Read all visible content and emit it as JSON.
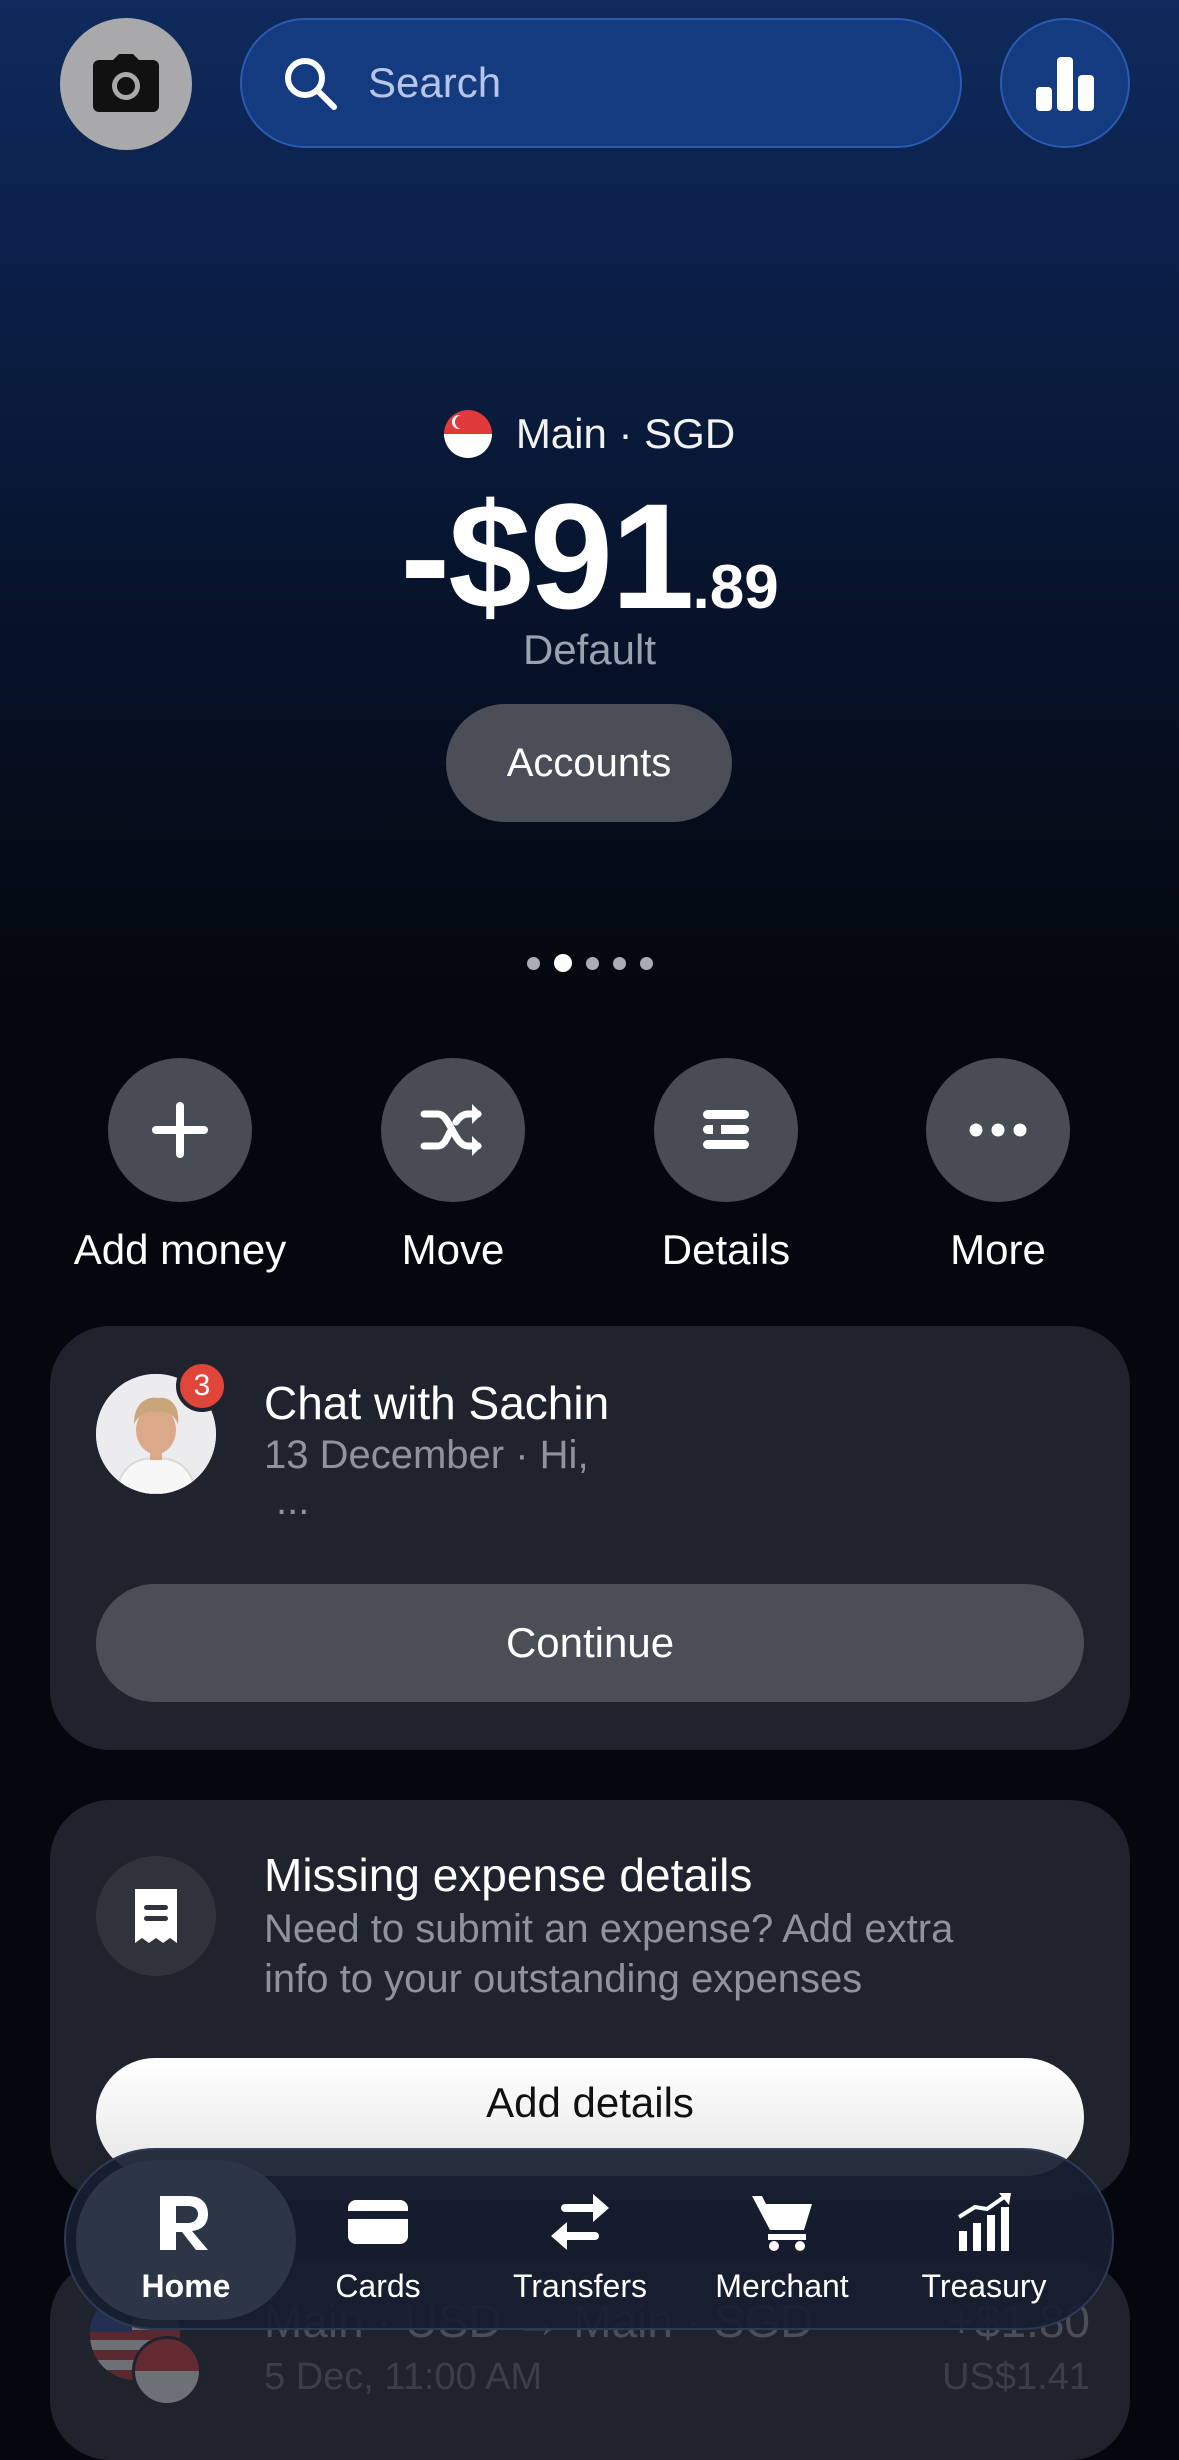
{
  "search": {
    "placeholder": "Search"
  },
  "account": {
    "name": "Main · SGD",
    "balance_main": "-$91",
    "balance_cents": ".89",
    "tag": "Default",
    "accounts_button": "Accounts"
  },
  "pager": {
    "count": 5,
    "active_index": 1
  },
  "actions": [
    {
      "label": "Add money",
      "icon": "plus-icon"
    },
    {
      "label": "Move",
      "icon": "shuffle-icon"
    },
    {
      "label": "Details",
      "icon": "details-icon"
    },
    {
      "label": "More",
      "icon": "more-icon"
    }
  ],
  "chat": {
    "title": "Chat with Sachin",
    "subtitle": "13 December · Hi,",
    "ellipsis": "...",
    "badge": "3",
    "button": "Continue"
  },
  "expense": {
    "title": "Missing expense details",
    "description_line1": "Need to submit an expense? Add extra",
    "description_line2": "info to your outstanding expenses",
    "button": "Add details"
  },
  "transaction": {
    "title": "Main · USD → Main · SGD",
    "subtitle": "5 Dec, 11:00 AM",
    "amount": "+$1.80",
    "amount_secondary": "US$1.41"
  },
  "nav": [
    {
      "label": "Home",
      "icon": "revolut-r-icon",
      "active": true
    },
    {
      "label": "Cards",
      "icon": "card-icon",
      "active": false
    },
    {
      "label": "Transfers",
      "icon": "transfers-icon",
      "active": false
    },
    {
      "label": "Merchant",
      "icon": "cart-icon",
      "active": false
    },
    {
      "label": "Treasury",
      "icon": "treasury-chart-icon",
      "active": false
    }
  ],
  "colors": {
    "accent_blue": "#143a80",
    "badge_red": "#e0453a",
    "card_bg": "#1f232d",
    "button_gray": "#4a4e57"
  }
}
